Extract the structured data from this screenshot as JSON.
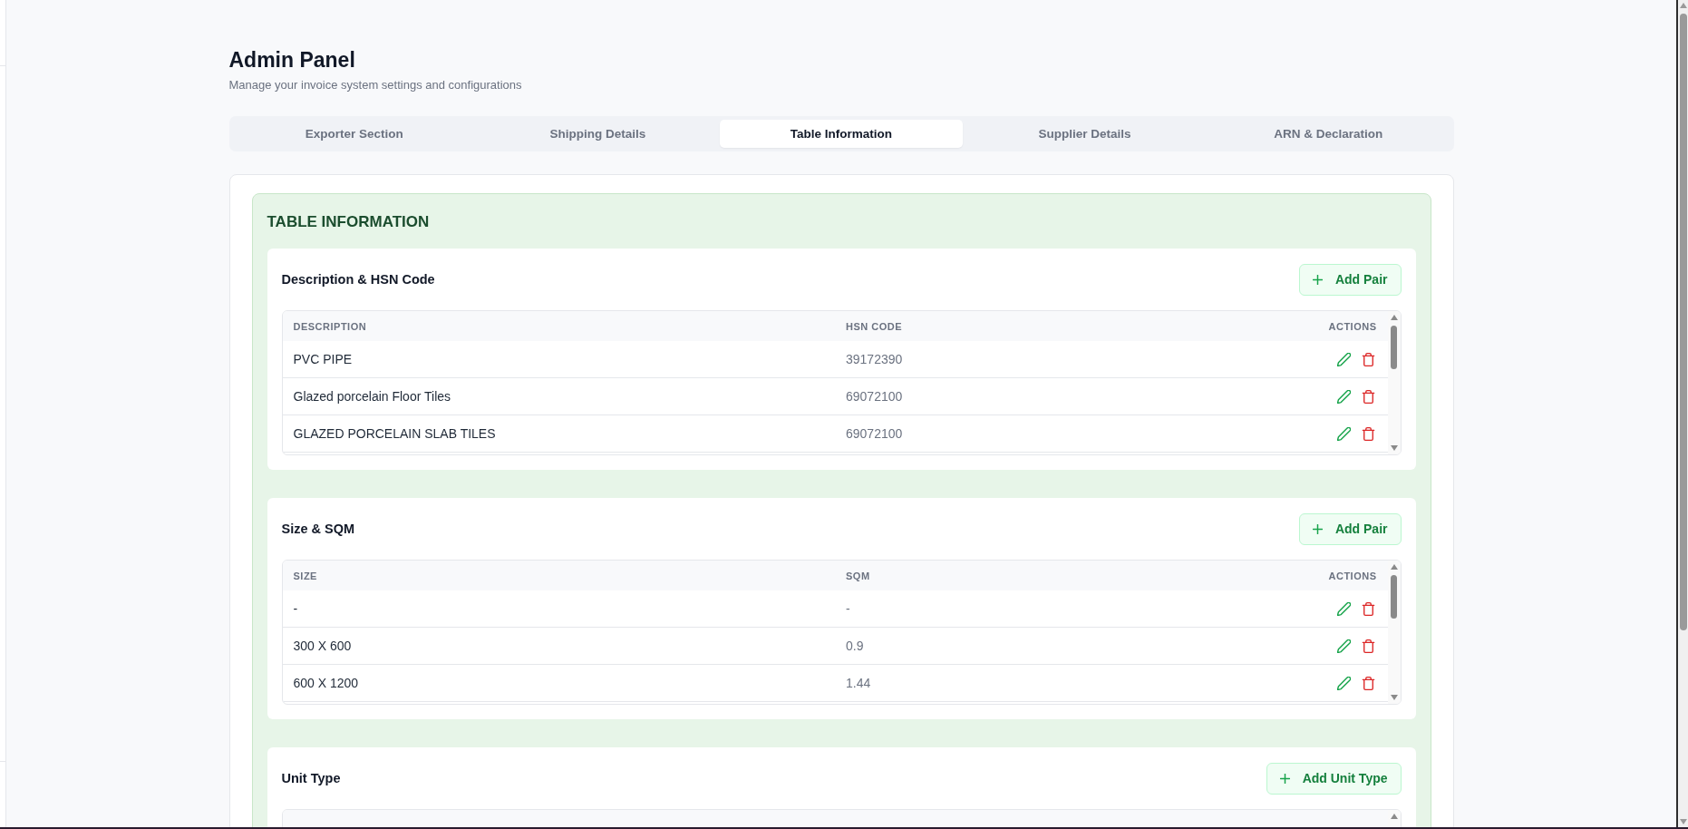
{
  "page": {
    "title": "Admin Panel",
    "subtitle": "Manage your invoice system settings and configurations"
  },
  "tabs": [
    {
      "label": "Exporter Section",
      "selected": false
    },
    {
      "label": "Shipping Details",
      "selected": false
    },
    {
      "label": "Table Information",
      "selected": true
    },
    {
      "label": "Supplier Details",
      "selected": false
    },
    {
      "label": "ARN & Declaration",
      "selected": false
    }
  ],
  "section": {
    "title": "TABLE INFORMATION",
    "cards": [
      {
        "title": "Description & HSN Code",
        "button": "Add Pair",
        "table": {
          "columns": [
            "DESCRIPTION",
            "HSN CODE",
            "ACTIONS"
          ],
          "rows": [
            [
              "PVC PIPE",
              "39172390"
            ],
            [
              "Glazed porcelain Floor Tiles",
              "69072100"
            ],
            [
              "GLAZED PORCELAIN SLAB TILES",
              "69072100"
            ]
          ]
        }
      },
      {
        "title": "Size & SQM",
        "button": "Add Pair",
        "table": {
          "columns": [
            "SIZE",
            "SQM",
            "ACTIONS"
          ],
          "rows": [
            [
              "-",
              "-"
            ],
            [
              "300 X 600",
              "0.9"
            ],
            [
              "600 X 1200",
              "1.44"
            ]
          ]
        }
      },
      {
        "title": "Unit Type",
        "button": "Add Unit Type"
      }
    ]
  }
}
